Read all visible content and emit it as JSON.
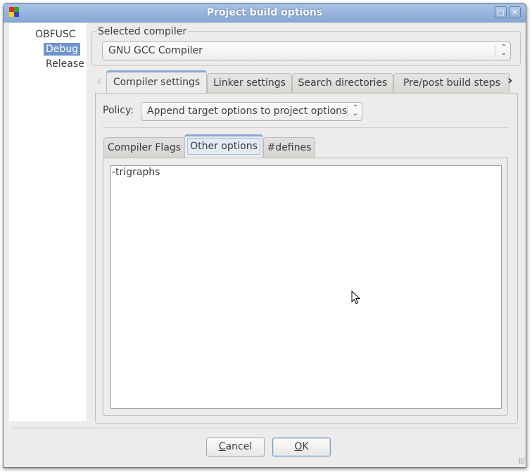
{
  "window": {
    "title": "Project build options",
    "controls": {
      "maximize": "□",
      "close": "✕"
    }
  },
  "targets": {
    "items": [
      {
        "label": "OBFUSC",
        "selected": false
      },
      {
        "label": "Debug",
        "selected": true
      },
      {
        "label": "Release",
        "selected": false
      }
    ]
  },
  "compiler": {
    "group_label": "Selected compiler",
    "selected": "GNU GCC Compiler"
  },
  "main_tabs": {
    "scroll_left": "‹",
    "scroll_right": "›",
    "items": [
      {
        "label": "Compiler settings",
        "active": true
      },
      {
        "label": "Linker settings",
        "active": false
      },
      {
        "label": "Search directories",
        "active": false
      },
      {
        "label": "Pre/post build steps",
        "active": false
      }
    ]
  },
  "policy": {
    "label": "Policy:",
    "selected": "Append target options to project options"
  },
  "sub_tabs": {
    "items": [
      {
        "label": "Compiler Flags",
        "active": false
      },
      {
        "label": "Other options",
        "active": true
      },
      {
        "label": "#defines",
        "active": false
      }
    ]
  },
  "other_options": {
    "text": "-trigraphs"
  },
  "buttons": {
    "cancel": {
      "mnemonic": "C",
      "rest": "ancel"
    },
    "ok": {
      "mnemonic": "O",
      "rest": "K"
    }
  },
  "colors": {
    "titlebar": "#87a7d5",
    "selection": "#6f93cc",
    "window_bg": "#edeceb",
    "tab_accent": "#8aa9d6"
  }
}
